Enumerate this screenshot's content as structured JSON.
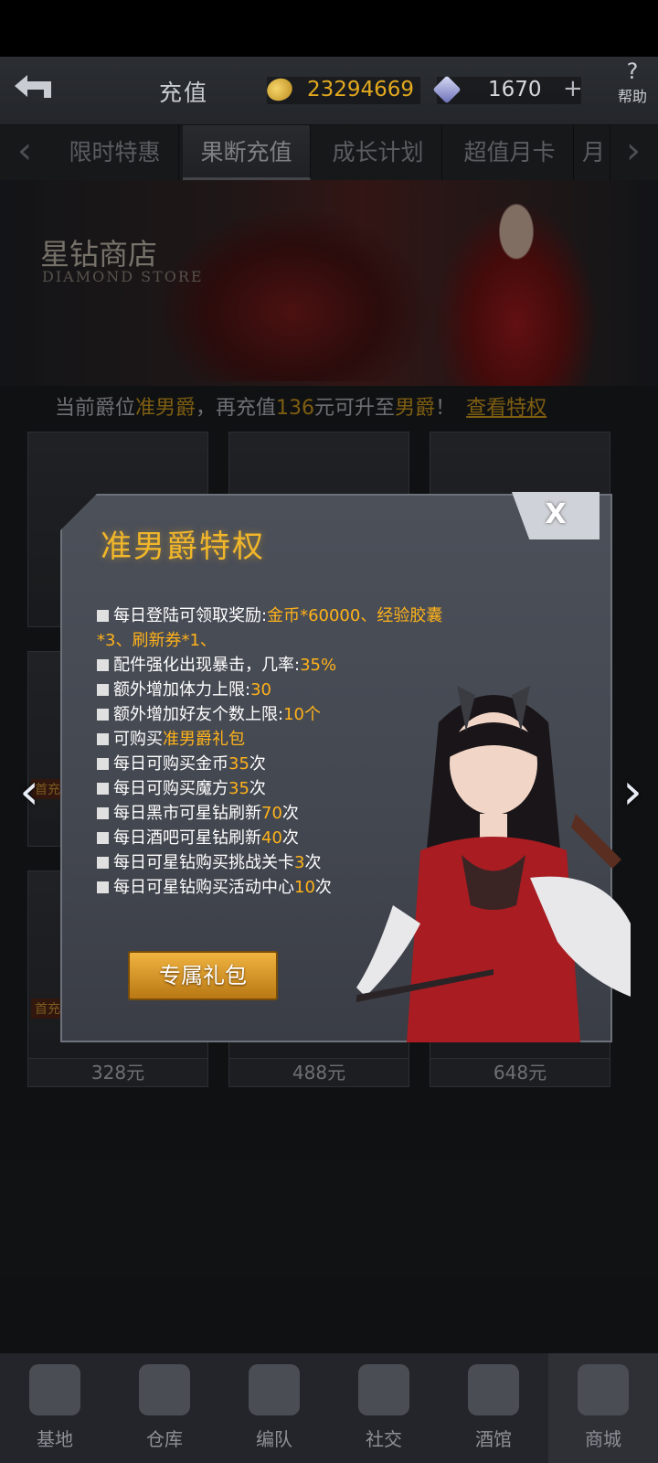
{
  "header": {
    "title": "充值",
    "gold": "23294669",
    "diamonds": "1670",
    "plus": "+",
    "help_label": "帮助",
    "help_icon": "?"
  },
  "tabs": {
    "prev_icon": "‹",
    "next_icon": "›",
    "items": [
      "限时特惠",
      "果断充值",
      "成长计划",
      "超值月卡",
      "月"
    ],
    "active": "果断充值"
  },
  "banner": {
    "title": "星钻商店",
    "subtitle": "DIAMOND STORE"
  },
  "rank_line": {
    "prefix": "当前爵位",
    "current_rank": "准男爵",
    "mid": "，再充值",
    "amount": "136",
    "mid2": "元可升至",
    "next_rank": "男爵",
    "suffix": "！",
    "link": "查看特权"
  },
  "store": {
    "first_tag": "首充",
    "prices": [
      "328元",
      "488元",
      "648元"
    ]
  },
  "popup": {
    "title": "准男爵特权",
    "close": "X",
    "perks": [
      {
        "text": "每日登陆可领取奖励:",
        "value": "金币*60000、经验胶囊"
      },
      {
        "text": "",
        "value": "*3、刷新券*1、"
      },
      {
        "text": "配件强化出现暴击，几率:",
        "value": "35%"
      },
      {
        "text": "额外增加体力上限:",
        "value": "30"
      },
      {
        "text": "额外增加好友个数上限:",
        "value": "10个"
      },
      {
        "text": "可购买",
        "value": "准男爵礼包"
      },
      {
        "text": "每日可购买金币",
        "value": "35",
        "after": "次"
      },
      {
        "text": "每日可购买魔方",
        "value": "35",
        "after": "次"
      },
      {
        "text": "每日黑市可星钻刷新",
        "value": "70",
        "after": "次"
      },
      {
        "text": "每日酒吧可星钻刷新",
        "value": "40",
        "after": "次"
      },
      {
        "text": "每日可星钻购买挑战关卡",
        "value": "3",
        "after": "次"
      },
      {
        "text": "每日可星钻购买活动中心",
        "value": "10",
        "after": "次"
      }
    ],
    "gift_button": "专属礼包"
  },
  "bottom_nav": {
    "items": [
      "基地",
      "仓库",
      "编队",
      "社交",
      "酒馆",
      "商城"
    ],
    "active": "商城"
  },
  "colors": {
    "accent": "#e3a91f",
    "perk_value": "#ffb21a",
    "title": "#f1b62a"
  }
}
